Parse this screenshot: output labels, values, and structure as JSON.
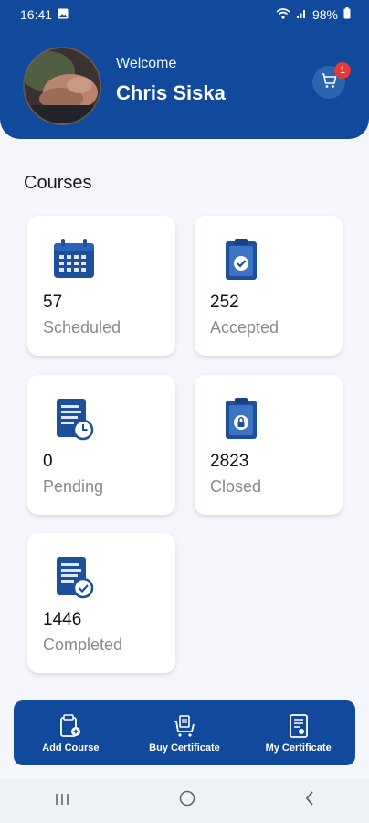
{
  "status": {
    "time": "16:41",
    "battery": "98%"
  },
  "header": {
    "welcome": "Welcome",
    "user_name": "Chris Siska",
    "cart_count": "1"
  },
  "courses": {
    "title": "Courses",
    "cards": [
      {
        "count": "57",
        "label": "Scheduled"
      },
      {
        "count": "252",
        "label": "Accepted"
      },
      {
        "count": "0",
        "label": "Pending"
      },
      {
        "count": "2823",
        "label": "Closed"
      },
      {
        "count": "1446",
        "label": "Completed"
      }
    ]
  },
  "actions": [
    {
      "label": "Add Course"
    },
    {
      "label": "Buy Certificate"
    },
    {
      "label": "My Certificate"
    }
  ],
  "colors": {
    "primary": "#114a9c",
    "badge": "#e53935",
    "icon_blue": "#1d4f9a"
  }
}
